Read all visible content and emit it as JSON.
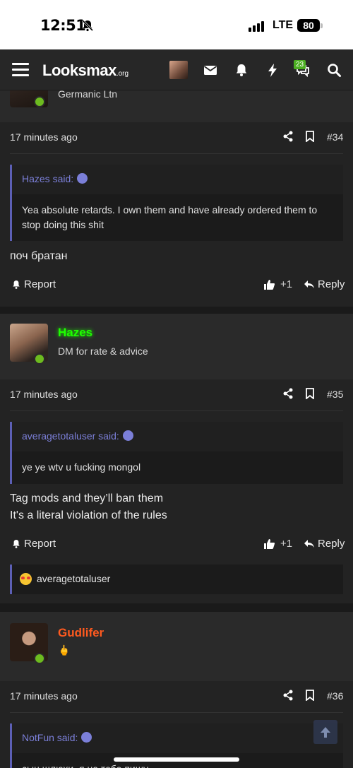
{
  "status_bar": {
    "time": "12:51",
    "network": "LTE",
    "battery": "80"
  },
  "navbar": {
    "logo_main": "Looksmax",
    "logo_suffix": ".org",
    "conversations_badge": "23"
  },
  "posts": [
    {
      "usertitle": "Germanic Ltn",
      "time": "17 minutes ago",
      "number": "#34",
      "quote_author": "Hazes said:",
      "quote_text": "Yea absolute retards. I own them and have already ordered them to stop doing this shit",
      "text": "поч братан",
      "report_label": "Report",
      "like_count": "+1",
      "reply_label": "Reply"
    },
    {
      "username": "Hazes",
      "username_color": "#1eff00",
      "usertitle": "DM for rate & advice",
      "time": "17 minutes ago",
      "number": "#35",
      "quote_author": "averagetotaluser said:",
      "quote_text": "ye ye wtv u fucking mongol",
      "text_line1": "Tag mods and they’ll ban them",
      "text_line2": "It's a literal violation of the rules",
      "report_label": "Report",
      "like_count": "+1",
      "reply_label": "Reply",
      "reaction_user": "averagetotaluser"
    },
    {
      "username": "Gudlifer",
      "username_color": "#ff5a1f",
      "usertitle": "🖕",
      "time": "17 minutes ago",
      "number": "#36",
      "quote_author": "NotFun said:",
      "quote_text_partial": "сын шлюхи, я не тебе пишу"
    }
  ],
  "colors": {
    "accent": "#5c5fb5",
    "online": "#6dbb1f",
    "link": "#7b7fd8"
  }
}
